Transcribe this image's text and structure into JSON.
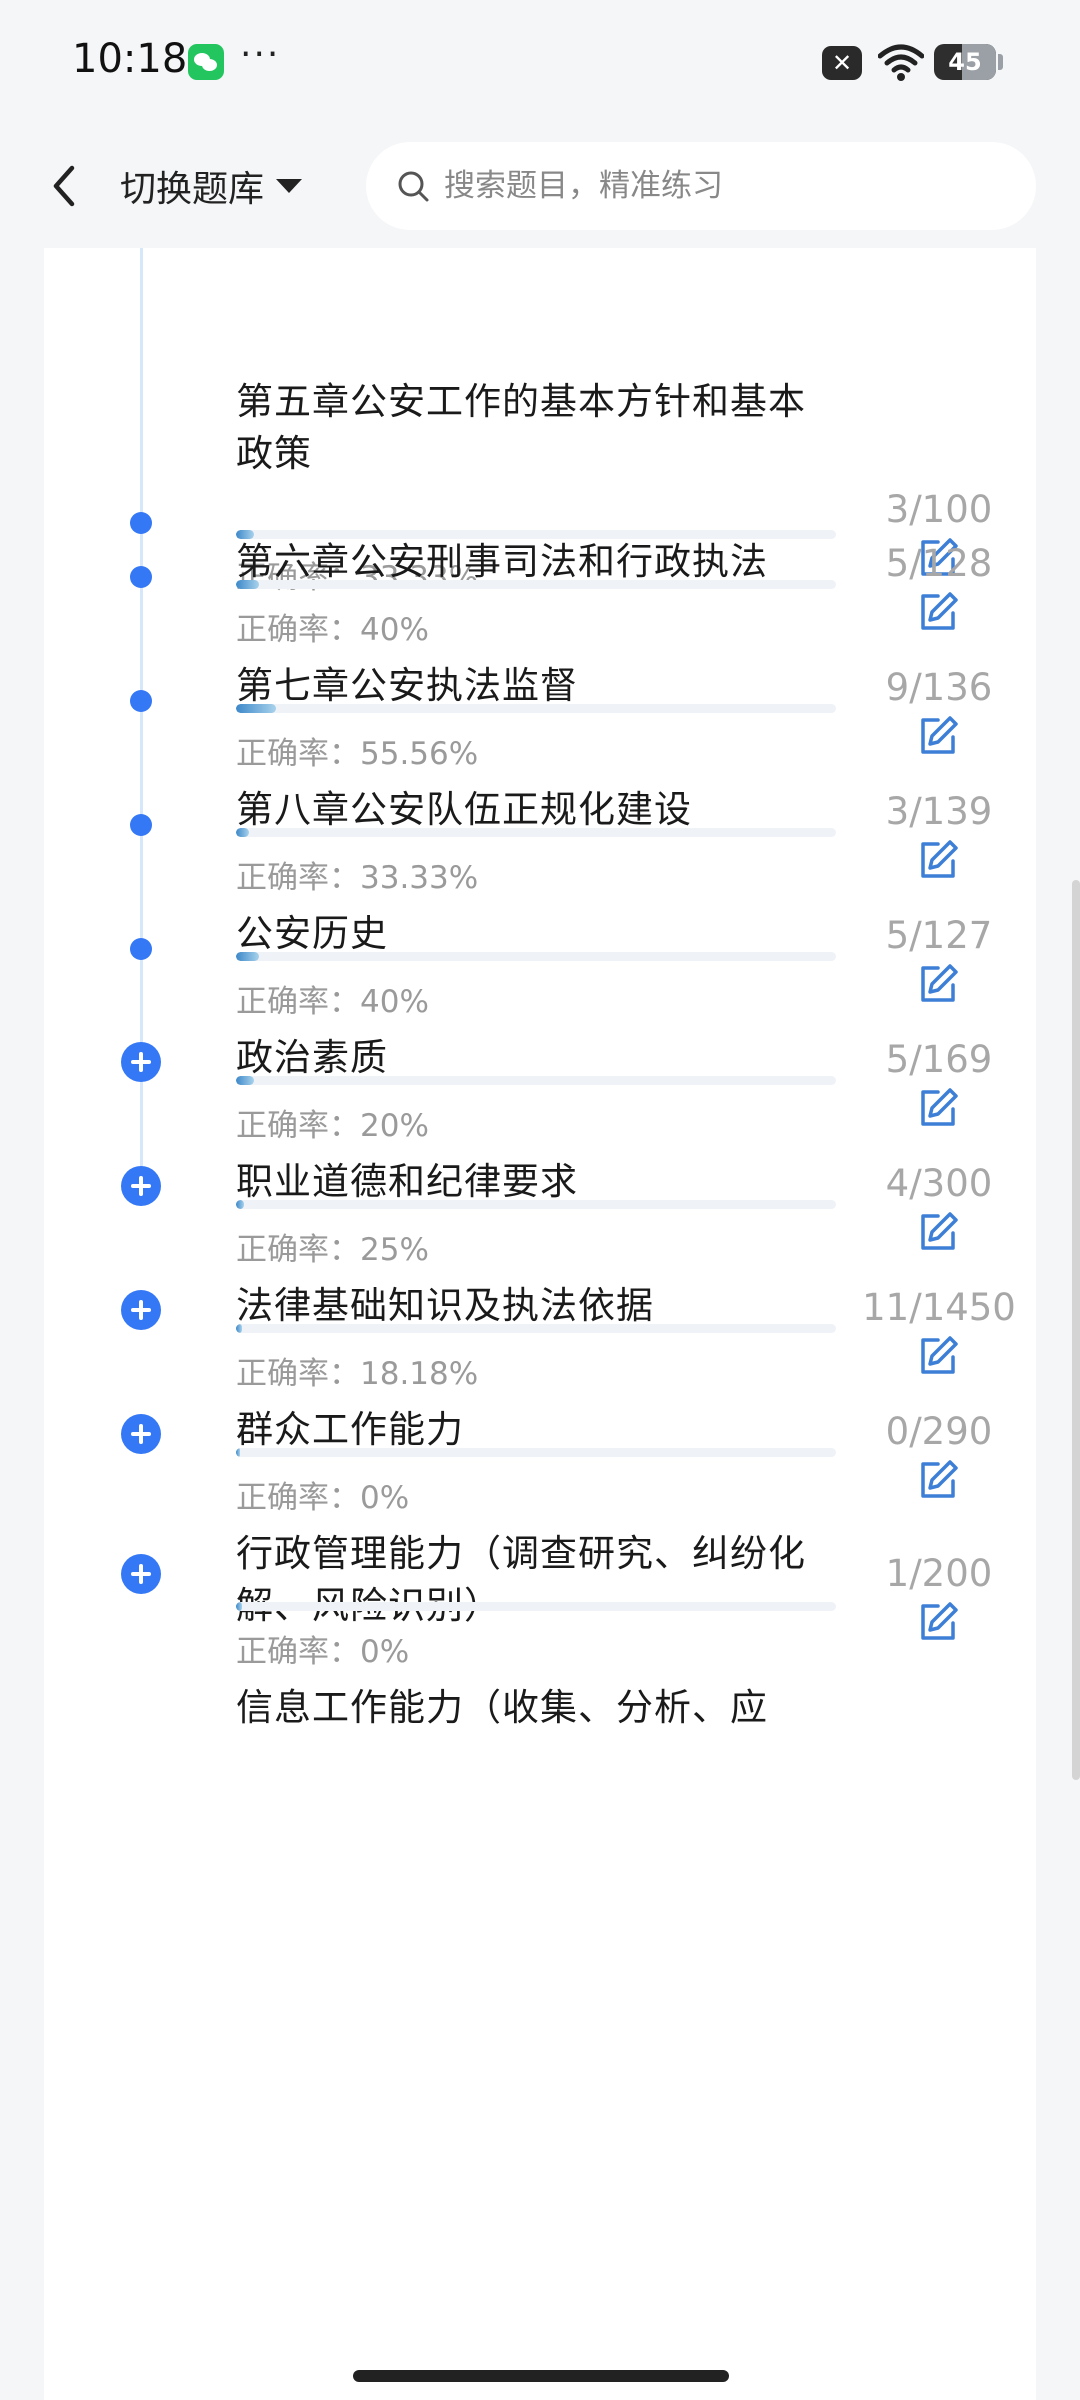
{
  "status_bar": {
    "time": "10:18",
    "more": "···",
    "close_badge": "✕",
    "battery_level": "45",
    "battery_fraction": 0.45
  },
  "header": {
    "bank_switch_label": "切换题库",
    "search_placeholder": "搜索题目，精准练习"
  },
  "accuracy_label": "正确率：",
  "chapters": [
    {
      "title": "第五章公安工作的基本方针和基本政策",
      "accuracy": "33.33%",
      "count": "3/100",
      "progress": 0.03,
      "marker": "dot"
    },
    {
      "title": "第六章公安刑事司法和行政执法",
      "accuracy": "40%",
      "count": "5/128",
      "progress": 0.039,
      "marker": "dot"
    },
    {
      "title": "第七章公安执法监督",
      "accuracy": "55.56%",
      "count": "9/136",
      "progress": 0.066,
      "marker": "dot"
    },
    {
      "title": "第八章公安队伍正规化建设",
      "accuracy": "33.33%",
      "count": "3/139",
      "progress": 0.022,
      "marker": "dot"
    },
    {
      "title": "公安历史",
      "accuracy": "40%",
      "count": "5/127",
      "progress": 0.039,
      "marker": "dot"
    },
    {
      "title": "政治素质",
      "accuracy": "20%",
      "count": "5/169",
      "progress": 0.03,
      "marker": "expand"
    },
    {
      "title": "职业道德和纪律要求",
      "accuracy": "25%",
      "count": "4/300",
      "progress": 0.013,
      "marker": "expand"
    },
    {
      "title": "法律基础知识及执法依据",
      "accuracy": "18.18%",
      "count": "11/1450",
      "progress": 0.008,
      "marker": "expand"
    },
    {
      "title": "群众工作能力",
      "accuracy": "0%",
      "count": "0/290",
      "progress": 0.0,
      "marker": "expand"
    },
    {
      "title": "行政管理能力（调查研究、纠纷化解、风险识别）",
      "accuracy": "0%",
      "count": "1/200",
      "progress": 0.005,
      "marker": "expand"
    },
    {
      "title": "信息工作能力（收集、分析、应",
      "accuracy": "",
      "count": "",
      "progress": null,
      "marker": "none"
    }
  ]
}
